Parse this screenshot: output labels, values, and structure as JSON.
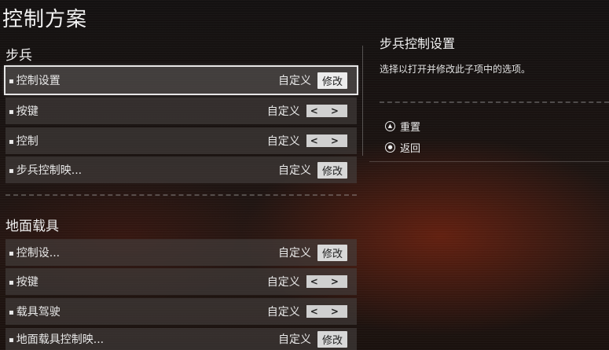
{
  "page": {
    "title": "控制方案"
  },
  "infantry": {
    "heading": "步兵",
    "rows": [
      {
        "label": "控制设置",
        "value": "自定义",
        "control": "修改"
      },
      {
        "label": "按键",
        "value": "自定义",
        "control": "< >"
      },
      {
        "label": "控制",
        "value": "自定义",
        "control": "< >"
      },
      {
        "label": "步兵控制映...",
        "value": "自定义",
        "control": "修改"
      }
    ]
  },
  "ground": {
    "heading": "地面载具",
    "rows": [
      {
        "label": "控制设...",
        "value": "自定义",
        "control": "修改"
      },
      {
        "label": "按键",
        "value": "自定义",
        "control": "< >"
      },
      {
        "label": "载具驾驶",
        "value": "自定义",
        "control": "< >"
      },
      {
        "label": "地面载具控制映...",
        "value": "自定义",
        "control": "修改"
      }
    ]
  },
  "panel": {
    "title": "步兵控制设置",
    "description": "选择以打开并修改此子项中的选项。",
    "hints": [
      {
        "icon": "triangle-button-icon",
        "label": "重置"
      },
      {
        "icon": "circle-button-icon",
        "label": "返回"
      }
    ]
  }
}
